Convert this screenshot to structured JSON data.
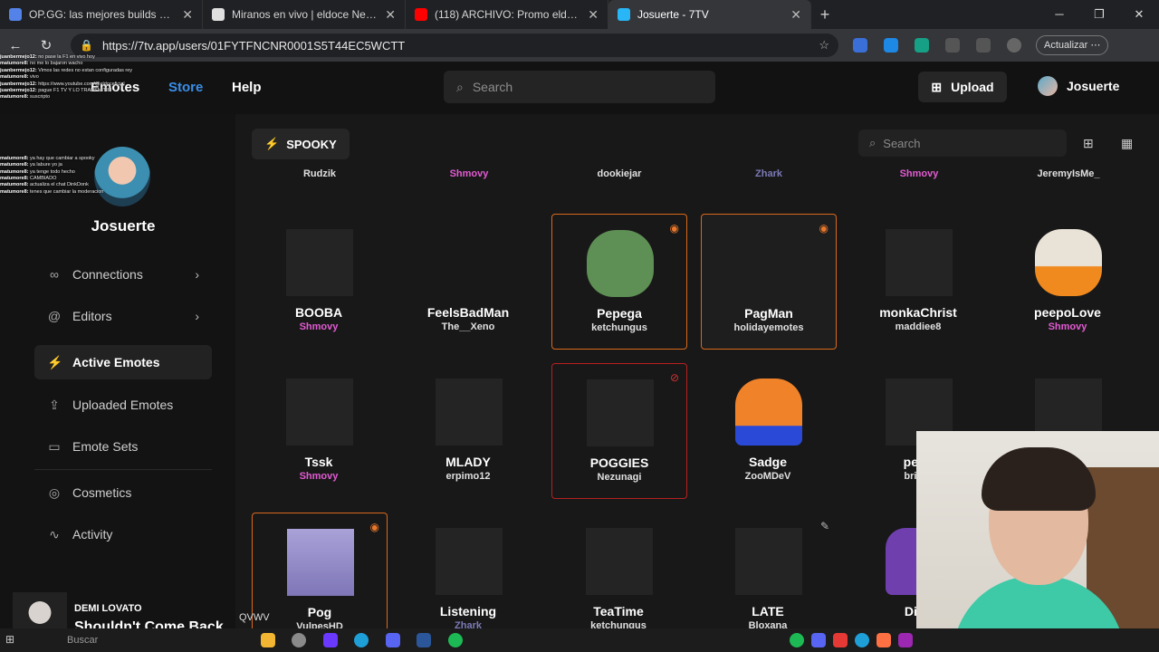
{
  "browser": {
    "tabs": [
      {
        "title": "OP.GG: las mejores builds y tier lis",
        "color": "#5383e8"
      },
      {
        "title": "Miranos en vivo | eldoce Neuquén",
        "color": "#e0e0e0"
      },
      {
        "title": "(118) ARCHIVO: Promo eldoce 6 a",
        "color": "#ff0000"
      },
      {
        "title": "Josuerte - 7TV",
        "color": "#29b6f6"
      }
    ],
    "new_tab": "+",
    "url": "https://7tv.app/users/01FYTFNCNR0001S5T44EC5WCTT",
    "update_label": "Actualizar"
  },
  "site": {
    "nav": {
      "emotes": "Emotes",
      "store": "Store",
      "help": "Help"
    },
    "search_placeholder": "Search",
    "upload_label": "Upload",
    "username": "Josuerte"
  },
  "sidebar": {
    "profile_name": "Josuerte",
    "items": [
      {
        "label": "Connections",
        "icon": "link-icon"
      },
      {
        "label": "Editors",
        "icon": "at-icon"
      },
      {
        "label": "Active Emotes",
        "icon": "bolt-icon"
      },
      {
        "label": "Uploaded Emotes",
        "icon": "upload-icon"
      },
      {
        "label": "Emote Sets",
        "icon": "folder-icon"
      },
      {
        "label": "Cosmetics",
        "icon": "palette-icon"
      },
      {
        "label": "Activity",
        "icon": "activity-icon"
      }
    ]
  },
  "main": {
    "emote_set": "SPOOKY",
    "search_placeholder": "Search",
    "top_row_authors": [
      "Rudzik",
      "Shmovy",
      "dookiejar",
      "Zhark",
      "Shmovy",
      "JeremyIsMe_"
    ],
    "emotes": [
      {
        "name": "BOOBA",
        "author": "Shmovy"
      },
      {
        "name": "FeelsBadMan",
        "author": "The__Xeno"
      },
      {
        "name": "Pepega",
        "author": "ketchungus"
      },
      {
        "name": "PagMan",
        "author": "holidayemotes"
      },
      {
        "name": "monkaChrist",
        "author": "maddiee8"
      },
      {
        "name": "peepoLove",
        "author": "Shmovy"
      },
      {
        "name": "Tssk",
        "author": "Shmovy"
      },
      {
        "name": "MLADY",
        "author": "erpimo12"
      },
      {
        "name": "POGGIES",
        "author": "Nezunagi"
      },
      {
        "name": "Sadge",
        "author": "ZooMDeV"
      },
      {
        "name": "peep",
        "author": "bright"
      },
      {
        "name": "Pog",
        "author": "VulpesHD"
      },
      {
        "name": "Listening",
        "author": "Zhark"
      },
      {
        "name": "TeaTime",
        "author": "ketchungus"
      },
      {
        "name": "LATE",
        "author": "Bloxana"
      },
      {
        "name": "Dink",
        "author": ""
      }
    ]
  },
  "chat_overlay": [
    {
      "user": "juanbermejo12:",
      "msg": "no pase la F1 en vivo hoy"
    },
    {
      "user": "matumore8:",
      "msg": "no me lo bajaron wacho"
    },
    {
      "user": "juanbermejo12:",
      "msg": "Vimos las redes no estan configuradas rey"
    },
    {
      "user": "matumore8:",
      "msg": "vivo"
    },
    {
      "user": "juanbermejo12:",
      "msg": "https://www.youtube.com/@eldoceficial"
    },
    {
      "user": "juanbermejo12:",
      "msg": "pague F1 TV Y LO TRANSMITIIII"
    },
    {
      "user": "matumore8:",
      "msg": "suscripto"
    },
    {
      "user": "matumore8:",
      "msg": "ya hay que cambiar a spooky"
    },
    {
      "user": "matumore8:",
      "msg": "ya labure yo ja"
    },
    {
      "user": "matumore8:",
      "msg": "ya tenge todo hecho"
    },
    {
      "user": "matumore8:",
      "msg": "CAMBIADO"
    },
    {
      "user": "matumore8:",
      "msg": "actualiza el chat DinkDonk"
    },
    {
      "user": "matumore8:",
      "msg": "tenes que cambiar la moderacion"
    }
  ],
  "music": {
    "artist": "DEMI LOVATO",
    "song": "Shouldn't Come Back",
    "extra": "QVWV"
  },
  "taskbar": {
    "search": "Buscar"
  }
}
